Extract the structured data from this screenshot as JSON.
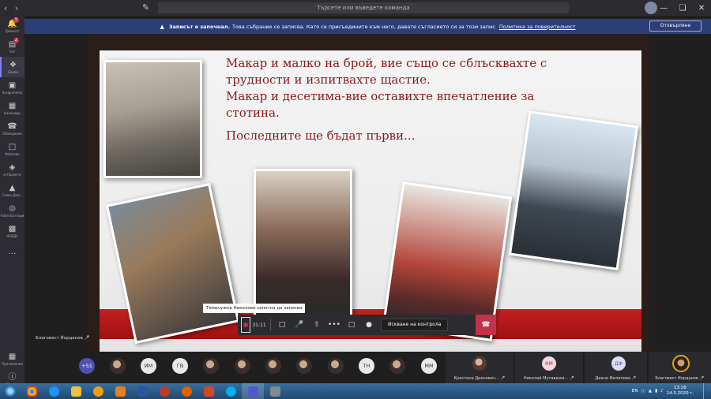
{
  "titlebar": {
    "search_placeholder": "Търсете или въведете команда",
    "icons": [
      "back-icon",
      "forward-icon",
      "compose-icon",
      "minimize-icon",
      "maximize-icon",
      "close-icon"
    ]
  },
  "rail": {
    "items": [
      {
        "label": "Дейност",
        "icon": "bell-icon",
        "badge": "5"
      },
      {
        "label": "Чат",
        "icon": "chat-icon",
        "badge": "2"
      },
      {
        "label": "Екипи",
        "icon": "teams-icon",
        "badge": ""
      },
      {
        "label": "Assignments",
        "icon": "assignments-icon",
        "badge": ""
      },
      {
        "label": "Календар",
        "icon": "calendar-icon",
        "badge": ""
      },
      {
        "label": "Обаждания",
        "icon": "phone-icon",
        "badge": ""
      },
      {
        "label": "Файлове",
        "icon": "files-icon",
        "badge": ""
      },
      {
        "label": "м-Проекти",
        "icon": "apps-icon",
        "badge": ""
      },
      {
        "label": "Слово Дем...",
        "icon": "word-icon",
        "badge": ""
      },
      {
        "label": "Клип България",
        "icon": "clip-icon",
        "badge": ""
      },
      {
        "label": "НОЕДУ",
        "icon": "building-icon",
        "badge": ""
      }
    ],
    "more": "...",
    "apps_label": "Приложения",
    "help_label": "Помощ"
  },
  "banner": {
    "title": "Записът е започнал.",
    "text": "Това събрание се записва. Като се присъедините към него, давате съгласието си за този запис.",
    "link": "Политика за поверителност",
    "dismiss": "Отхвърляне"
  },
  "slide": {
    "line1": "Макар и малко на брой, вие също се сблъсквахте с трудности и изпитвахте щастие.",
    "line2": "Макар и десетима-вие оставихте впечатление за стотина.",
    "line3": "Последните ще бъдат първи..."
  },
  "presenter": "Благовест Йорданов",
  "toast": "Теменужка Николова започна да записва",
  "toolbar": {
    "timer": "31:11",
    "ask_control": "Искване на контрола"
  },
  "participants": {
    "more_count": "+51",
    "initials": [
      "ИМ",
      "ГВ",
      "ТН",
      "ММ"
    ],
    "tiles": [
      {
        "name": "Кристина Дренович...",
        "type": "photo"
      },
      {
        "name": "Николай Мутавджи...",
        "initials": "НМ",
        "type": "pink"
      },
      {
        "name": "Диана Филипова",
        "initials": "ДФ",
        "type": "lav"
      },
      {
        "name": "Благовест Йорданов",
        "type": "me"
      }
    ]
  },
  "taskbar": {
    "lang": "EN",
    "time": "13:28",
    "date": "14.5.2020 г."
  },
  "colors": {
    "accent": "#7b83eb",
    "banner": "#2c3e7a",
    "slide_text": "#8b1a1a",
    "hangup": "#c4314b"
  }
}
